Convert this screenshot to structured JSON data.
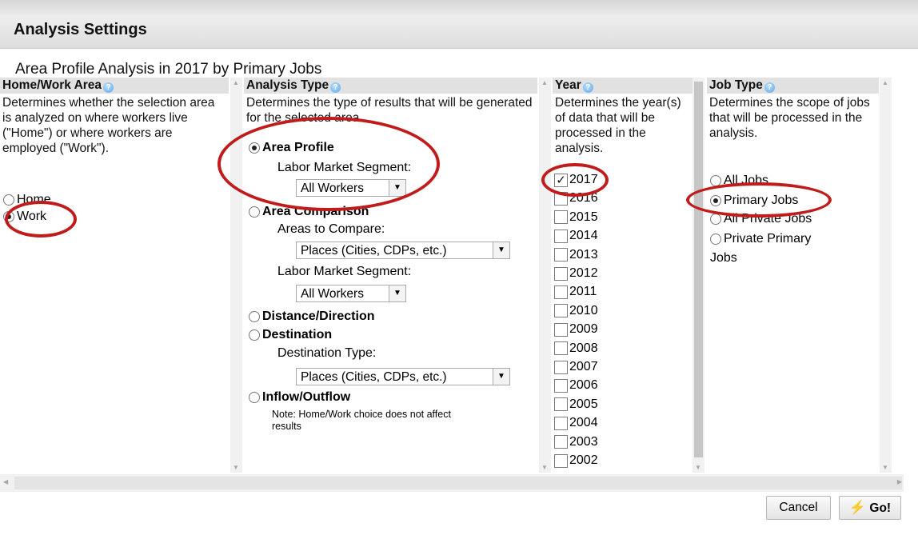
{
  "dialog": {
    "title": "Analysis Settings",
    "subtitle": "Area Profile Analysis in 2017 by Primary Jobs"
  },
  "home_work": {
    "header": "Home/Work Area",
    "description": "Determines whether the selection area is analyzed on where workers live (\"Home\") or where workers are employed (\"Work\").",
    "options": [
      {
        "label": "Home",
        "checked": false
      },
      {
        "label": "Work",
        "checked": true
      }
    ]
  },
  "analysis_type": {
    "header": "Analysis Type",
    "description": "Determines the type of results that will be generated for the selected area.",
    "area_profile": {
      "label": "Area Profile",
      "checked": true,
      "segment_label": "Labor Market Segment:",
      "segment_value": "All Workers"
    },
    "area_comparison": {
      "label": "Area Comparison",
      "checked": false,
      "compare_label": "Areas to Compare:",
      "compare_value": "Places (Cities, CDPs, etc.)",
      "segment_label": "Labor Market Segment:",
      "segment_value": "All Workers"
    },
    "distance_direction": {
      "label": "Distance/Direction",
      "checked": false
    },
    "destination": {
      "label": "Destination",
      "checked": false,
      "type_label": "Destination Type:",
      "type_value": "Places (Cities, CDPs, etc.)"
    },
    "inflow_outflow": {
      "label": "Inflow/Outflow",
      "checked": false,
      "note": "Note: Home/Work choice does not affect results"
    }
  },
  "year": {
    "header": "Year",
    "description": "Determines the year(s) of data that will be processed in the analysis.",
    "years": [
      {
        "label": "2017",
        "checked": true
      },
      {
        "label": "2016",
        "checked": false
      },
      {
        "label": "2015",
        "checked": false
      },
      {
        "label": "2014",
        "checked": false
      },
      {
        "label": "2013",
        "checked": false
      },
      {
        "label": "2012",
        "checked": false
      },
      {
        "label": "2011",
        "checked": false
      },
      {
        "label": "2010",
        "checked": false
      },
      {
        "label": "2009",
        "checked": false
      },
      {
        "label": "2008",
        "checked": false
      },
      {
        "label": "2007",
        "checked": false
      },
      {
        "label": "2006",
        "checked": false
      },
      {
        "label": "2005",
        "checked": false
      },
      {
        "label": "2004",
        "checked": false
      },
      {
        "label": "2003",
        "checked": false
      },
      {
        "label": "2002",
        "checked": false
      }
    ]
  },
  "job_type": {
    "header": "Job Type",
    "description": "Determines the scope of jobs that will be processed in the analysis.",
    "options": [
      {
        "label": "All Jobs",
        "checked": false
      },
      {
        "label": "Primary Jobs",
        "checked": true
      },
      {
        "label": "All Private Jobs",
        "checked": false
      },
      {
        "label": "Private Primary",
        "checked": false
      }
    ],
    "wrap_text": "Jobs"
  },
  "buttons": {
    "cancel": "Cancel",
    "go": "Go!"
  },
  "colors": {
    "annotation": "#c01c1c",
    "header_bg": "#e1e1e1",
    "title_bg": "#dedede"
  }
}
